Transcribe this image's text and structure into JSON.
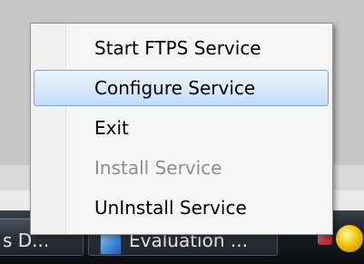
{
  "taskbar": {
    "left_button_label": "s D...",
    "middle_button_label": "Evaluation ...",
    "middle_button_icon": "document-icon",
    "tray_icons": [
      "network-icon",
      "status-orb-icon"
    ]
  },
  "context_menu": {
    "items": [
      {
        "label": "Start FTPS Service",
        "state": "normal"
      },
      {
        "label": "Configure Service",
        "state": "selected"
      },
      {
        "label": "Exit",
        "state": "normal"
      },
      {
        "label": "Install Service",
        "state": "disabled"
      },
      {
        "label": "UnInstall Service",
        "state": "normal"
      }
    ]
  },
  "colors": {
    "menu_background": "#f6f6f6",
    "highlight_border": "#7da2ce",
    "highlight_fill": "#dbeaf8",
    "disabled_text": "#8d8d8d",
    "taskbar": "#1a1e24"
  }
}
